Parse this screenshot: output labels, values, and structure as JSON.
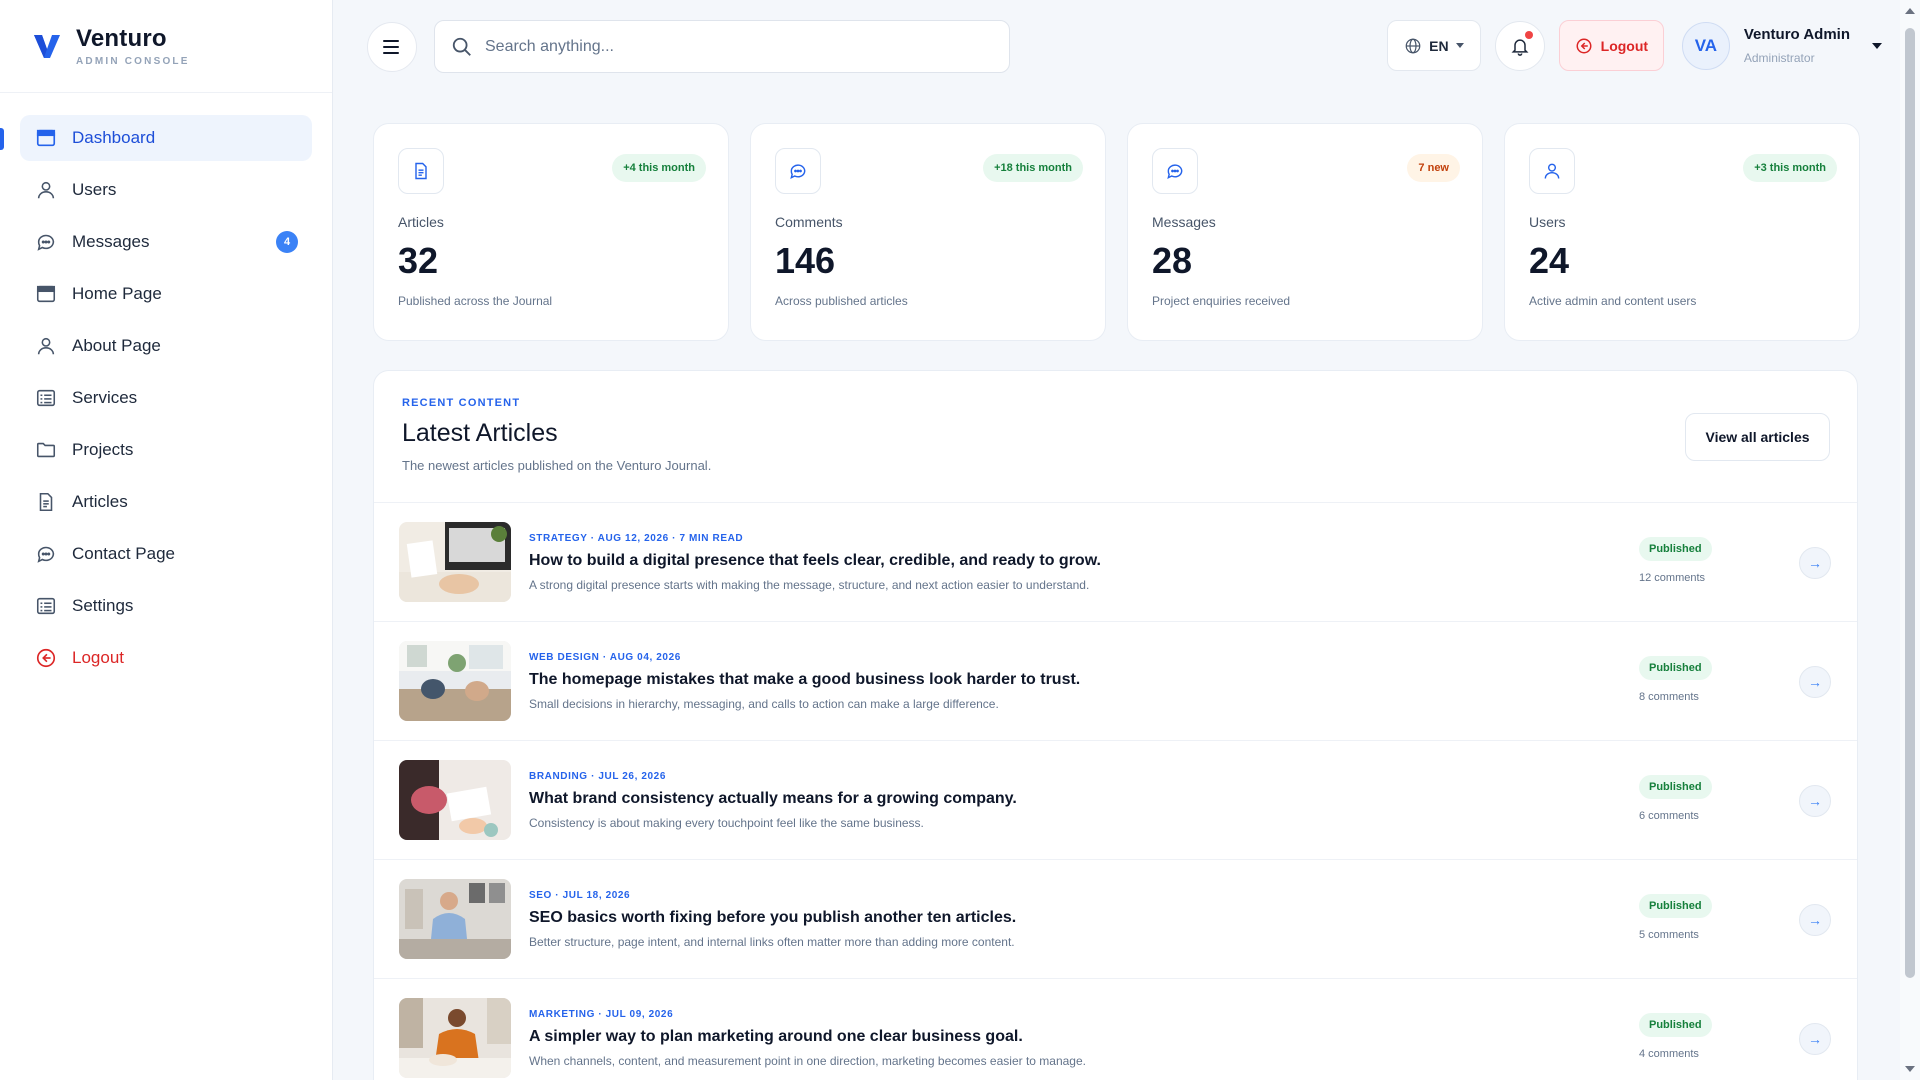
{
  "brand": {
    "name": "Venturo",
    "subtitle": "ADMIN CONSOLE"
  },
  "sidebar": {
    "items": [
      {
        "label": "Dashboard",
        "icon": "dashboard-icon",
        "active": true
      },
      {
        "label": "Users",
        "icon": "user-icon"
      },
      {
        "label": "Messages",
        "icon": "chat-icon",
        "badge": "4"
      },
      {
        "label": "Home Page",
        "icon": "window-icon"
      },
      {
        "label": "About Page",
        "icon": "user-icon"
      },
      {
        "label": "Services",
        "icon": "list-icon"
      },
      {
        "label": "Projects",
        "icon": "folder-icon"
      },
      {
        "label": "Articles",
        "icon": "document-icon"
      },
      {
        "label": "Contact Page",
        "icon": "chat-icon"
      },
      {
        "label": "Settings",
        "icon": "list-icon"
      },
      {
        "label": "Logout",
        "icon": "logout-icon"
      }
    ]
  },
  "topbar": {
    "search_placeholder": "Search anything...",
    "language": "EN",
    "logout_label": "Logout",
    "user": {
      "initials": "VA",
      "name": "Venturo Admin",
      "role": "Administrator"
    }
  },
  "stats": [
    {
      "label": "Articles",
      "value": "32",
      "description": "Published across the Journal",
      "pill": "+4 this month",
      "pill_tone": "green",
      "icon": "document-icon"
    },
    {
      "label": "Comments",
      "value": "146",
      "description": "Across published articles",
      "pill": "+18 this month",
      "pill_tone": "green",
      "icon": "chat-icon"
    },
    {
      "label": "Messages",
      "value": "28",
      "description": "Project enquiries received",
      "pill": "7 new",
      "pill_tone": "orange",
      "icon": "chat-icon"
    },
    {
      "label": "Users",
      "value": "24",
      "description": "Active admin and content users",
      "pill": "+3 this month",
      "pill_tone": "green",
      "icon": "user-icon"
    }
  ],
  "articles_panel": {
    "eyebrow": "RECENT CONTENT",
    "title": "Latest Articles",
    "subtitle": "The newest articles published on the Venturo Journal.",
    "view_all_label": "View all articles",
    "rows": [
      {
        "meta": "STRATEGY · AUG 12, 2026 · 7 MIN READ",
        "title": "How to build a digital presence that feels clear, credible, and ready to grow.",
        "excerpt": "A strong digital presence starts with making the message, structure, and next action easier to understand.",
        "status": "Published",
        "comments": "12 comments"
      },
      {
        "meta": "WEB DESIGN · AUG 04, 2026",
        "title": "The homepage mistakes that make a good business look harder to trust.",
        "excerpt": "Small decisions in hierarchy, messaging, and calls to action can make a large difference.",
        "status": "Published",
        "comments": "8 comments"
      },
      {
        "meta": "BRANDING · JUL 26, 2026",
        "title": "What brand consistency actually means for a growing company.",
        "excerpt": "Consistency is about making every touchpoint feel like the same business.",
        "status": "Published",
        "comments": "6 comments"
      },
      {
        "meta": "SEO · JUL 18, 2026",
        "title": "SEO basics worth fixing before you publish another ten articles.",
        "excerpt": "Better structure, page intent, and internal links often matter more than adding more content.",
        "status": "Published",
        "comments": "5 comments"
      },
      {
        "meta": "MARKETING · JUL 09, 2026",
        "title": "A simpler way to plan marketing around one clear business goal.",
        "excerpt": "When channels, content, and measurement point in one direction, marketing becomes easier to manage.",
        "status": "Published",
        "comments": "4 comments"
      }
    ]
  },
  "colors": {
    "accent": "#2563eb",
    "danger": "#dc2626",
    "success": "#16803c",
    "warning": "#c2410c"
  }
}
